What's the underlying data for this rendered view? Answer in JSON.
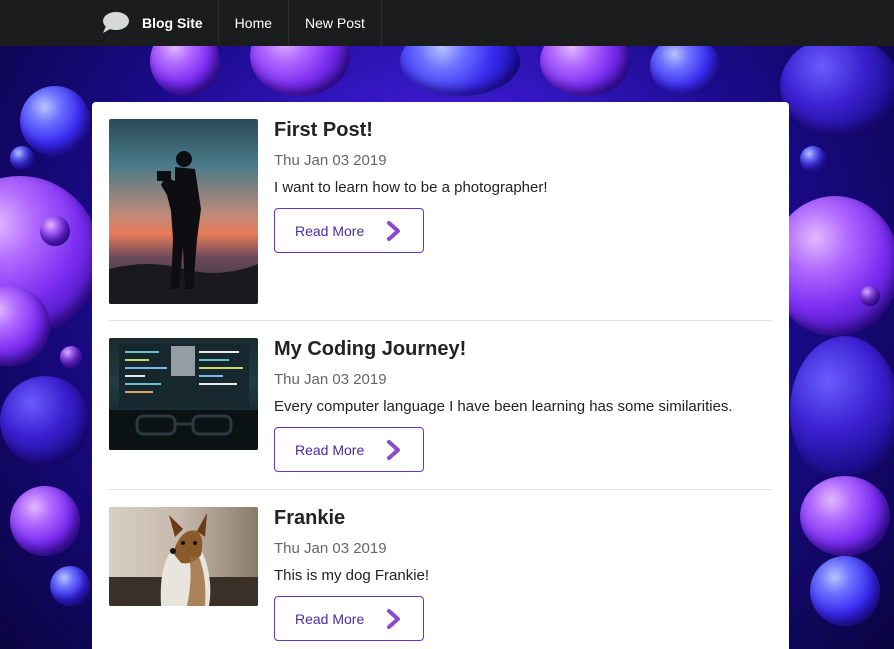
{
  "navbar": {
    "brand_label": "Blog Site",
    "brand_icon": "speech-bubble-icon",
    "items": [
      {
        "label": "Home"
      },
      {
        "label": "New Post"
      }
    ]
  },
  "posts": [
    {
      "title": "First Post!",
      "date": "Thu Jan 03 2019",
      "description": "I want to learn how to be a photographer!",
      "button_label": "Read More",
      "image": "photographer-silhouette-sunset"
    },
    {
      "title": "My Coding Journey!",
      "date": "Thu Jan 03 2019",
      "description": "Every computer language I have been learning has some similarities.",
      "button_label": "Read More",
      "image": "code-on-laptop-with-glasses"
    },
    {
      "title": "Frankie",
      "date": "Thu Jan 03 2019",
      "description": "This is my dog Frankie!",
      "button_label": "Read More",
      "image": "yorkshire-terrier-dog"
    }
  ],
  "colors": {
    "navbar_bg": "#1b1c1d",
    "button_border": "#6435c9",
    "button_text": "#4a2ca0",
    "chevron": "#8a4ad0"
  }
}
